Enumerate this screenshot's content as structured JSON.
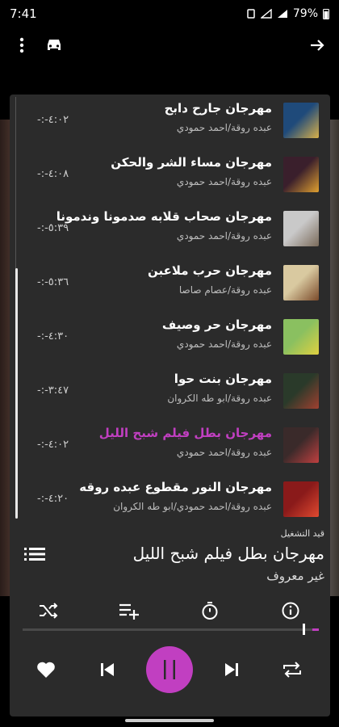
{
  "status": {
    "time": "7:41",
    "battery": "79%"
  },
  "now_playing": {
    "label": "قيد التشغيل",
    "title": "مهرجان  بطل فيلم شبح الليل",
    "artist": "غير معروف",
    "progress": 0.98
  },
  "tracks": [
    {
      "title": "مهرجان جارح دابح",
      "artist": "عبده روقة/احمد حمودي",
      "duration": "-:-٤:٠٢",
      "active": false,
      "thumb_colors": [
        "#1f4a7a",
        "#d8b04a"
      ]
    },
    {
      "title": "مهرجان  مساء الشر والحكن",
      "artist": "عبده روقة/احمد حمودي",
      "duration": "-:-٤:٠٨",
      "active": false,
      "thumb_colors": [
        "#3a1f2c",
        "#e0a030"
      ]
    },
    {
      "title": "مهرجان  صحاب قلابه صدمونا وندمونا",
      "artist": "عبده روقة/احمد حمودي",
      "duration": "-:-٥:٣٩",
      "active": false,
      "thumb_colors": [
        "#c9c9c9",
        "#7a6a5a"
      ]
    },
    {
      "title": "مهرجان  حرب ملاعبن",
      "artist": "عبده روقة/عصام صاصا",
      "duration": "-:-٥:٣٦",
      "active": false,
      "thumb_colors": [
        "#d9c9a0",
        "#7a4a2a"
      ]
    },
    {
      "title": "مهرجان  حر وصيف",
      "artist": "عبده روقة/احمد حمودي",
      "duration": "-:-٤:٣٠",
      "active": false,
      "thumb_colors": [
        "#8ac060",
        "#e0d040"
      ]
    },
    {
      "title": "مهرجان  بنت حوا",
      "artist": "عبده روقة/ابو طه الكروان",
      "duration": "-:-٣:٤٧",
      "active": false,
      "thumb_colors": [
        "#2a3a2a",
        "#a04030"
      ]
    },
    {
      "title": "مهرجان  بطل فيلم شبح الليل",
      "artist": "عبده روقة/احمد حمودي",
      "duration": "-:-٤:٠٢",
      "active": true,
      "thumb_colors": [
        "#3a2a2a",
        "#c04040"
      ]
    },
    {
      "title": "مهرجان  النور مقطوع  عبده روقه",
      "artist": "عبده روقة/احمد حمودي/ابو طه الكروان",
      "duration": "-:-٤:٢٠",
      "active": false,
      "thumb_colors": [
        "#8a1a1a",
        "#e04a30"
      ]
    }
  ],
  "colors": {
    "accent": "#c13fc1",
    "sheet": "#2b2b2b"
  }
}
